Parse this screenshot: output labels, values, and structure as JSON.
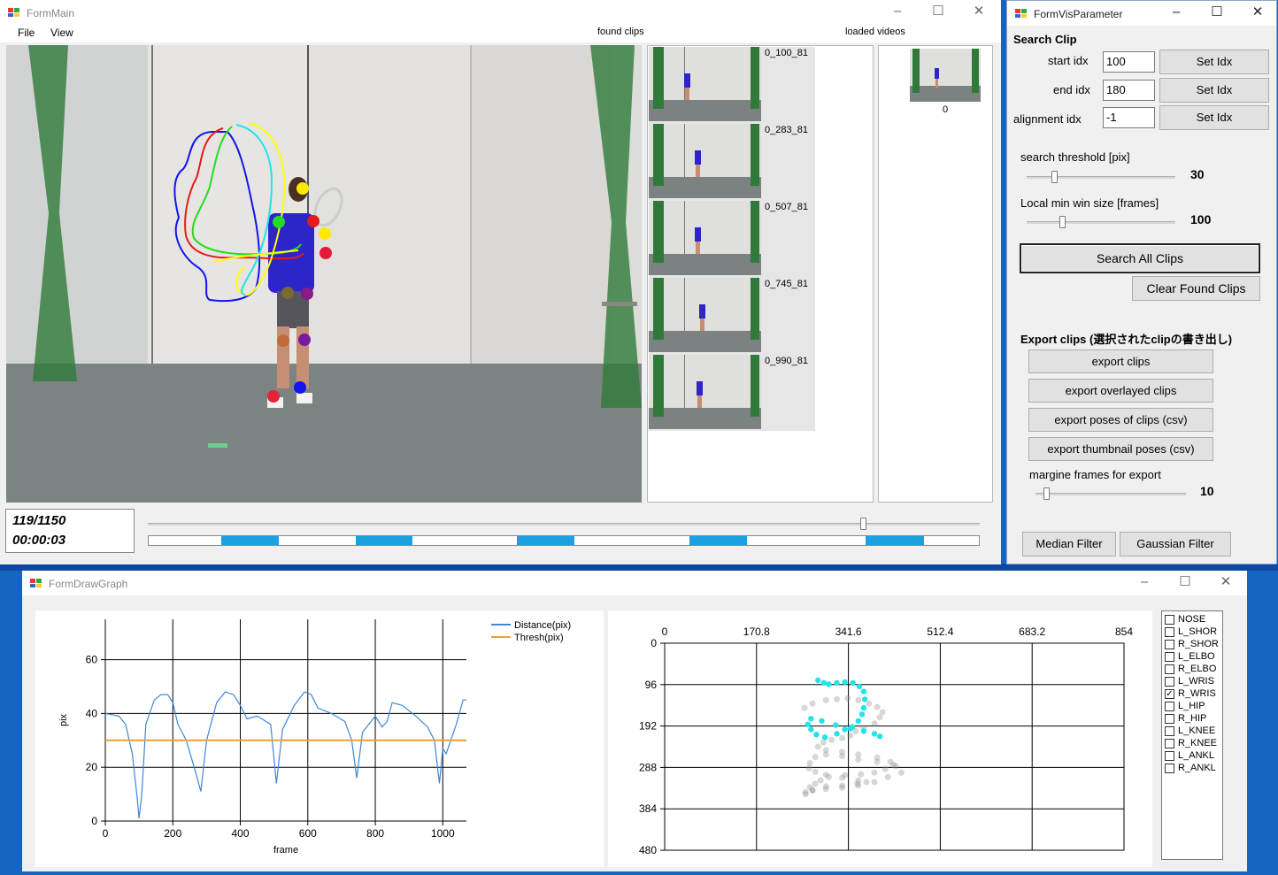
{
  "form_main": {
    "title": "FormMain",
    "menu": [
      "File",
      "View"
    ],
    "found_clips_label": "found clips",
    "loaded_videos_label": "loaded videos",
    "frame_counter": "119/1150",
    "timecode": "00:00:03",
    "timeline_position": 0.86,
    "found_clips": [
      {
        "label": "0_100_81"
      },
      {
        "label": "0_283_81"
      },
      {
        "label": "0_507_81"
      },
      {
        "label": "0_745_81"
      },
      {
        "label": "0_990_81"
      }
    ],
    "loaded_videos": [
      {
        "label": "0"
      }
    ],
    "timeline_segments_fraction": [
      [
        0.087,
        0.157
      ],
      [
        0.249,
        0.318
      ],
      [
        0.443,
        0.513
      ],
      [
        0.651,
        0.721
      ],
      [
        0.864,
        0.934
      ]
    ]
  },
  "form_vis_parameter": {
    "title": "FormVisParameter",
    "search_clip_heading": "Search Clip",
    "start_idx_label": "start idx",
    "start_idx_value": "100",
    "end_idx_label": "end idx",
    "end_idx_value": "180",
    "alignment_idx_label": "alignment idx",
    "alignment_idx_value": "-1",
    "set_idx_label": "Set Idx",
    "search_threshold_label": "search threshold [pix]",
    "search_threshold_value": "30",
    "local_min_label": "Local min win size [frames]",
    "local_min_value": "100",
    "search_all_label": "Search  All Clips",
    "clear_found_label": "Clear Found Clips",
    "export_heading": "Export clips (選択されたclipの書き出し)",
    "export_buttons": [
      "export clips",
      "export overlayed clips",
      "export poses of clips (csv)",
      "export thumbnail poses (csv)"
    ],
    "margin_label": "margine frames for export",
    "margin_value": "10",
    "median_filter_label": "Median Filter",
    "gaussian_filter_label": "Gaussian Filter"
  },
  "form_draw_graph": {
    "title": "FormDrawGraph",
    "joints": [
      {
        "name": "NOSE",
        "checked": false
      },
      {
        "name": "L_SHOR",
        "checked": false
      },
      {
        "name": "R_SHOR",
        "checked": false
      },
      {
        "name": "L_ELBO",
        "checked": false
      },
      {
        "name": "R_ELBO",
        "checked": false
      },
      {
        "name": "L_WRIS",
        "checked": false
      },
      {
        "name": "R_WRIS",
        "checked": true
      },
      {
        "name": "L_HIP",
        "checked": false
      },
      {
        "name": "R_HIP",
        "checked": false
      },
      {
        "name": "L_KNEE",
        "checked": false
      },
      {
        "name": "R_KNEE",
        "checked": false
      },
      {
        "name": "L_ANKL",
        "checked": false
      },
      {
        "name": "R_ANKL",
        "checked": false
      }
    ]
  },
  "chart_data": [
    {
      "type": "line",
      "xlabel": "frame",
      "ylabel": "pix",
      "xlim": [
        0,
        1070
      ],
      "ylim": [
        0,
        75
      ],
      "x_ticks": [
        "0",
        "200",
        "400",
        "600",
        "800",
        "1000"
      ],
      "y_ticks": [
        "0",
        "20",
        "40",
        "60"
      ],
      "legend_position": "top-right",
      "series": [
        {
          "name": "Distance(pix)",
          "color": "#3d87d8",
          "x": [
            0,
            40,
            60,
            80,
            95,
            100,
            108,
            120,
            145,
            165,
            185,
            200,
            215,
            240,
            270,
            283,
            300,
            330,
            355,
            380,
            400,
            420,
            450,
            490,
            507,
            525,
            560,
            590,
            610,
            630,
            670,
            710,
            730,
            745,
            762,
            800,
            820,
            835,
            850,
            880,
            920,
            955,
            975,
            990,
            1000,
            1010,
            1040,
            1060,
            1070
          ],
          "values": [
            40,
            39,
            36,
            25,
            8,
            1,
            10,
            36,
            45,
            47,
            47,
            44,
            36,
            30,
            17,
            11,
            30,
            44,
            48,
            47,
            43,
            38,
            39,
            36,
            14,
            34,
            43,
            48,
            47,
            42,
            40,
            37,
            30,
            16,
            33,
            39,
            35,
            37,
            44,
            43,
            39,
            35,
            30,
            14,
            27,
            25,
            36,
            45,
            45
          ]
        },
        {
          "name": "Thresh(pix)",
          "color": "#f0a030",
          "x": [
            0,
            1070
          ],
          "values": [
            30,
            30
          ]
        }
      ]
    },
    {
      "type": "scatter",
      "xlim": [
        0,
        854
      ],
      "ylim": [
        0,
        480
      ],
      "y_axis_inverted": true,
      "x_ticks": [
        "0",
        "170.8",
        "341.6",
        "512.4",
        "683.2",
        "854"
      ],
      "y_ticks": [
        "0",
        "96",
        "192",
        "288",
        "384",
        "480"
      ],
      "series": [
        {
          "name": "R_WRIS",
          "color": "#22e3e8",
          "x": [
            285,
            296,
            305,
            320,
            335,
            350,
            362,
            370,
            372,
            370,
            367,
            360,
            349,
            335,
            320,
            298,
            282,
            272,
            266,
            272,
            292,
            318,
            345,
            370,
            390,
            400
          ],
          "y": [
            86,
            92,
            95,
            92,
            90,
            92,
            100,
            112,
            130,
            150,
            165,
            180,
            194,
            200,
            210,
            218,
            212,
            200,
            188,
            175,
            180,
            190,
            198,
            204,
            210,
            216
          ]
        },
        {
          "name": "",
          "color": "#8c8c8c",
          "x": [
            260,
            275,
            300,
            320,
            340,
            360,
            380,
            395,
            405,
            400,
            390,
            370,
            355,
            345,
            330,
            310,
            295,
            285,
            300,
            330,
            360,
            395,
            420,
            430,
            410,
            390,
            365,
            335,
            305,
            290,
            280,
            270,
            262,
            275,
            300,
            330,
            358,
            390,
            415,
            440,
            425,
            395,
            360,
            330,
            300,
            280,
            270,
            268,
            280,
            300,
            330,
            360,
            375,
            360,
            330,
            300,
            275,
            262
          ],
          "y": [
            150,
            140,
            132,
            130,
            128,
            132,
            140,
            148,
            160,
            172,
            186,
            196,
            204,
            214,
            220,
            224,
            230,
            240,
            248,
            252,
            258,
            265,
            275,
            285,
            292,
            300,
            304,
            306,
            310,
            318,
            326,
            334,
            345,
            340,
            332,
            330,
            326,
            322,
            310,
            300,
            282,
            275,
            270,
            262,
            258,
            264,
            278,
            290,
            298,
            305,
            312,
            318,
            322,
            330,
            335,
            338,
            342,
            350
          ]
        }
      ]
    }
  ]
}
